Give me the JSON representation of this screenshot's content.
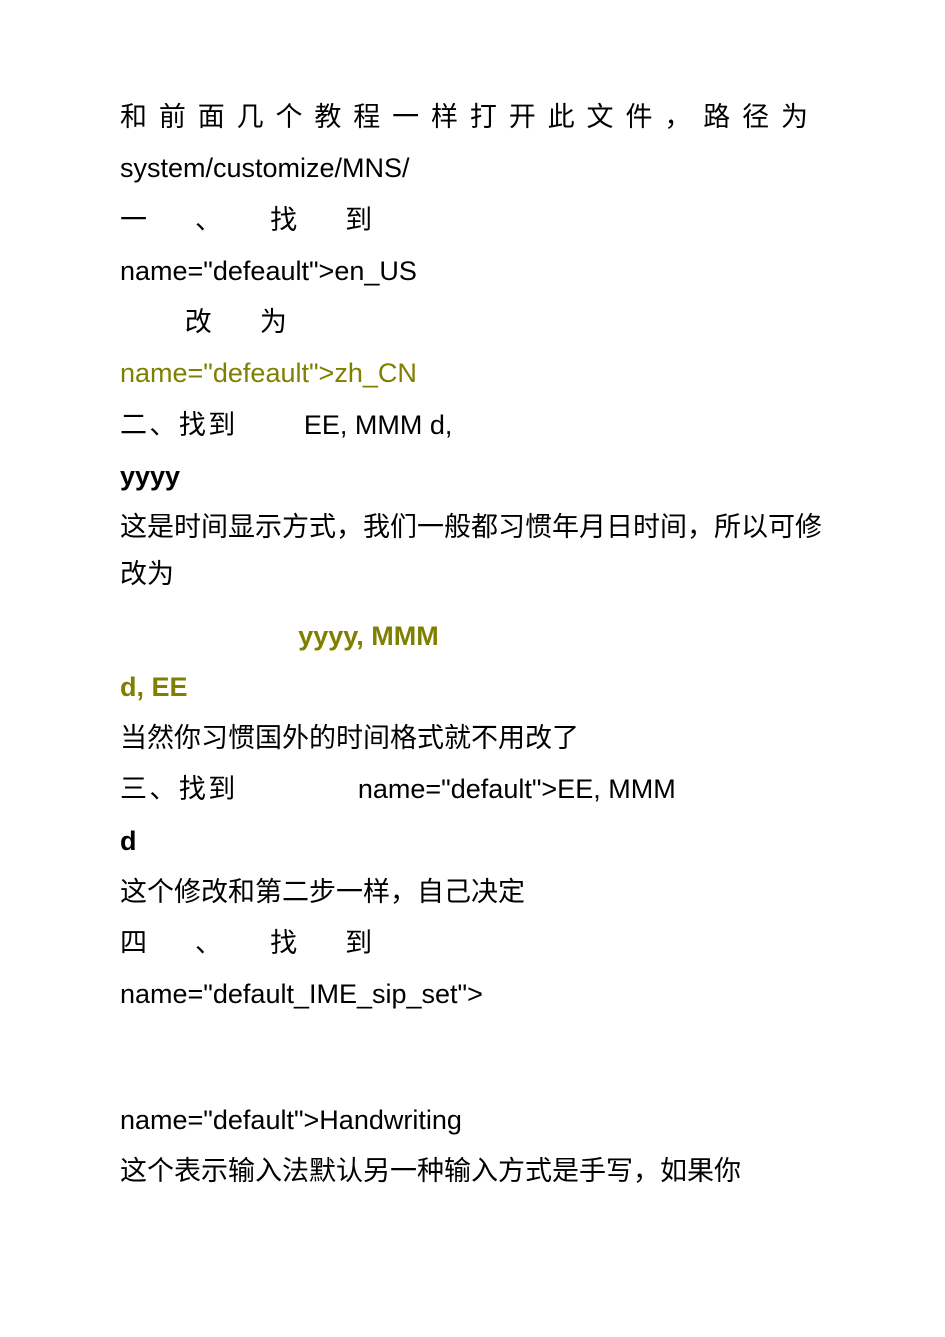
{
  "lines": {
    "l1": "和前面几个教程一样打开此文件，路径为",
    "l2": "system/customize/MNS/",
    "l3a": "一、找到",
    "l4": "name=\"defeault\">en_US",
    "l5": "改为",
    "l6": "name=\"defeault\">zh_CN",
    "l7a": "二、找到",
    "l7b": "EE, MMM d,",
    "l8": "yyyy",
    "l9": "这是时间显示方式，我们一般都习惯年月日时间，所以可修改为",
    "l10b": "yyyy, MMM",
    "l11": "d, EE",
    "l12": "当然你习惯国外的时间格式就不用改了",
    "l13a": "三、找到",
    "l13b": "name=\"default\">EE,  MMM",
    "l14": "d",
    "l15": "这个修改和第二步一样，自己决定",
    "l16": "四、找到",
    "l17": "name=\"default_IME_sip_set\">",
    "l18": "name=\"default\">Handwriting",
    "l19": "这个表示输入法默认另一种输入方式是手写，如果你"
  }
}
